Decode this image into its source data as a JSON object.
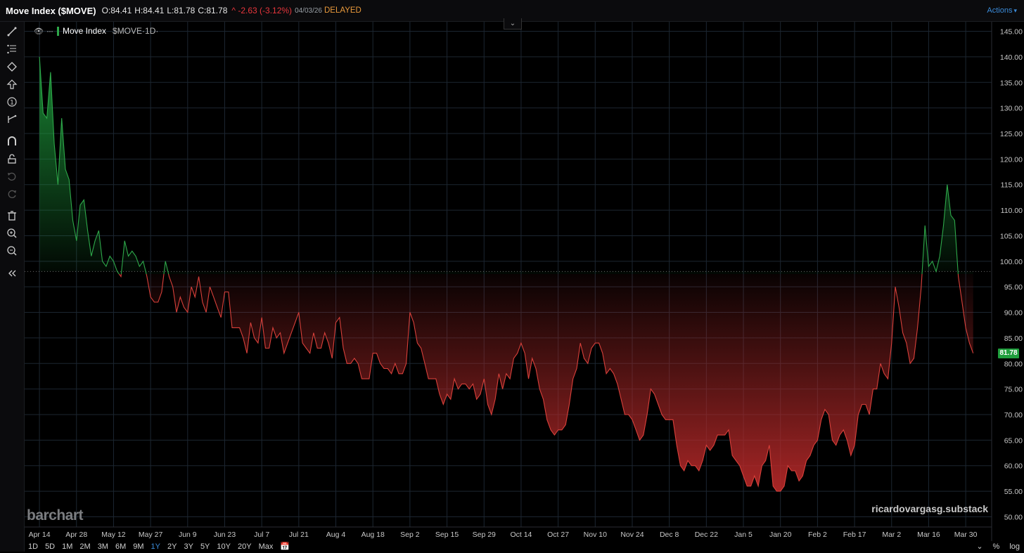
{
  "header": {
    "title": "Move Index ($MOVE)",
    "open": "O:84.41",
    "high": "H:84.41",
    "low": "L:81.78",
    "close": "C:81.78",
    "change": "^ -2.63 (-3.12%)",
    "date": "04/03/26",
    "status": "DELAYED",
    "actions_label": "Actions"
  },
  "legend": {
    "name": "Move Index",
    "symbol": "$MOVE·1D·"
  },
  "last_value_badge": "81.78",
  "watermarks": {
    "brand": "barchart",
    "source": "ricardovargasg.substack"
  },
  "range_buttons": [
    "1D",
    "5D",
    "1M",
    "2M",
    "3M",
    "6M",
    "9M",
    "1Y",
    "2Y",
    "3Y",
    "5Y",
    "10Y",
    "20Y",
    "Max"
  ],
  "active_range": "1Y",
  "bottom_right": {
    "pct": "%",
    "log": "log"
  },
  "colors": {
    "above": "#2ea84a",
    "below": "#d9403a",
    "background": "#000000",
    "grid": "#1f2a36",
    "badge": "#1f9e3d",
    "accent": "#3b8bd8"
  },
  "toolbar_icons": [
    "trend-line-icon",
    "fib-icon",
    "shapes-icon",
    "arrow-icon",
    "annotation-icon",
    "measure-icon",
    "magnet-icon",
    "lock-icon",
    "undo-icon",
    "redo-icon",
    "trash-icon",
    "zoom-in-icon",
    "zoom-out-icon",
    "collapse-left-icon"
  ],
  "chart_data": {
    "type": "area",
    "baseline": 98,
    "ylim": [
      48,
      147
    ],
    "y_ticks": [
      50,
      55,
      60,
      65,
      70,
      75,
      80,
      85,
      90,
      95,
      100,
      105,
      110,
      115,
      120,
      125,
      130,
      135,
      140,
      145
    ],
    "y_tick_labels": [
      "50.00",
      "55.00",
      "60.00",
      "65.00",
      "70.00",
      "75.00",
      "80.00",
      "85.00",
      "90.00",
      "95.00",
      "100.00",
      "105.00",
      "110.00",
      "115.00",
      "120.00",
      "125.00",
      "130.00",
      "135.00",
      "140.00",
      "145.00"
    ],
    "x_tick_labels": [
      "Apr 14",
      "Apr 28",
      "May 12",
      "May 27",
      "Jun 9",
      "Jun 23",
      "Jul 7",
      "Jul 21",
      "Aug 4",
      "Aug 18",
      "Sep 2",
      "Sep 15",
      "Sep 29",
      "Oct 14",
      "Oct 27",
      "Nov 10",
      "Nov 24",
      "Dec 8",
      "Dec 22",
      "Jan 5",
      "Jan 20",
      "Feb 2",
      "Feb 17",
      "Mar 2",
      "Mar 16",
      "Mar 30"
    ],
    "x_tick_index": [
      0,
      10,
      20,
      30,
      40,
      50,
      60,
      70,
      80,
      90,
      100,
      110,
      120,
      130,
      140,
      150,
      160,
      170,
      180,
      190,
      200,
      210,
      220,
      230,
      240,
      250
    ],
    "x_domain": [
      -4,
      257
    ],
    "series": [
      {
        "values": [
          140,
          129,
          128,
          137,
          123,
          115,
          128,
          118,
          116,
          108,
          104,
          111,
          112,
          106,
          101,
          104,
          106,
          100,
          99,
          101,
          100,
          98,
          97,
          104,
          101,
          102,
          101,
          99,
          100,
          97,
          93,
          92,
          92,
          94,
          100,
          97,
          95,
          90,
          93,
          91,
          90,
          95,
          93,
          97,
          92,
          90,
          95,
          93,
          91,
          89,
          94,
          94,
          87,
          87,
          87,
          85,
          82,
          88,
          85,
          84,
          89,
          83,
          83,
          87,
          85,
          86,
          82,
          84,
          86,
          88,
          90,
          84,
          83,
          82,
          86,
          83,
          83,
          86,
          84,
          81,
          88,
          89,
          83,
          80,
          80,
          81,
          80,
          77,
          77,
          77,
          82,
          82,
          80,
          79,
          79,
          78,
          80,
          78,
          78,
          80,
          90,
          88,
          84,
          83,
          80,
          77,
          77,
          77,
          74,
          72,
          74,
          73,
          77,
          75,
          76,
          76,
          75,
          76,
          73,
          74,
          77,
          72,
          70,
          73,
          78,
          75,
          78,
          77,
          81,
          82,
          84,
          82,
          77,
          81,
          79,
          75,
          73,
          69,
          67,
          66,
          67,
          67,
          68,
          72,
          77,
          79,
          84,
          81,
          80,
          83,
          84,
          84,
          82,
          78,
          79,
          78,
          76,
          73,
          70,
          70,
          69,
          67,
          65,
          66,
          70,
          75,
          74,
          72,
          70,
          69,
          69,
          69,
          64,
          60,
          59,
          61,
          60,
          60,
          59,
          61,
          64,
          63,
          64,
          66,
          66,
          66,
          67,
          62,
          61,
          60,
          58,
          56,
          56,
          58,
          56,
          60,
          61,
          64,
          56,
          55,
          55,
          56,
          60,
          59,
          59,
          57,
          58,
          61,
          62,
          64,
          65,
          69,
          71,
          70,
          65,
          64,
          66,
          67,
          65,
          62,
          64,
          70,
          72,
          72,
          70,
          75,
          75,
          80,
          78,
          77,
          84,
          95,
          91,
          86,
          84,
          80,
          81,
          87,
          95,
          107,
          99,
          100,
          98,
          101,
          107,
          115,
          109,
          108,
          97,
          92,
          87,
          84,
          82
        ]
      }
    ]
  }
}
